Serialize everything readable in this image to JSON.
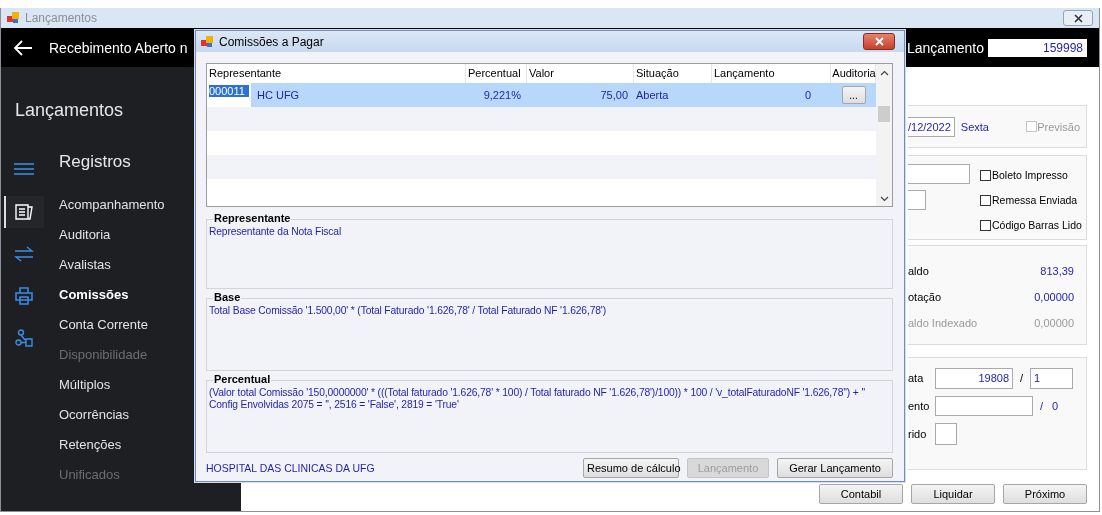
{
  "window": {
    "title": "Lançamentos"
  },
  "header": {
    "title": "Recebimento Aberto n",
    "lancamento_label": "Lançamento",
    "lancamento_value": "159998"
  },
  "sidebar": {
    "title": "Lançamentos",
    "section": "Registros",
    "icons": [
      {
        "kind": "document",
        "selected": true
      },
      {
        "kind": "arrows",
        "selected": false
      },
      {
        "kind": "printer",
        "selected": false
      },
      {
        "kind": "network",
        "selected": false
      }
    ],
    "items": [
      {
        "label": "Acompanhamento",
        "selected": false,
        "disabled": false
      },
      {
        "label": "Auditoria",
        "selected": false,
        "disabled": false
      },
      {
        "label": "Avalistas",
        "selected": false,
        "disabled": false
      },
      {
        "label": "Comissões",
        "selected": true,
        "disabled": false
      },
      {
        "label": "Conta Corrente",
        "selected": false,
        "disabled": false
      },
      {
        "label": "Disponibilidade",
        "selected": false,
        "disabled": true
      },
      {
        "label": "Múltiplos",
        "selected": false,
        "disabled": false
      },
      {
        "label": "Ocorrências",
        "selected": false,
        "disabled": false
      },
      {
        "label": "Retenções",
        "selected": false,
        "disabled": false
      },
      {
        "label": "Unificados",
        "selected": false,
        "disabled": true
      }
    ]
  },
  "right_panel": {
    "date": "/12/2022",
    "weekday": "Sexta",
    "previsao": {
      "label": "Previsão",
      "checked": false,
      "disabled": true
    },
    "checkboxes": [
      {
        "label": "Boleto Impresso",
        "checked": false
      },
      {
        "label": "Remessa Enviada",
        "checked": false
      },
      {
        "label": "Código Barras Lido",
        "checked": false
      }
    ],
    "totals": [
      {
        "label": "aldo",
        "value": "813,39",
        "disabled": false
      },
      {
        "label": "otação",
        "value": "0,00000",
        "disabled": false
      },
      {
        "label": "aldo Indexado",
        "value": "0,00000",
        "disabled": true
      }
    ],
    "parcel_rows": [
      {
        "kind": "pair",
        "label": "ata",
        "value": "19808",
        "separator": "/",
        "second_value": "1"
      },
      {
        "kind": "count",
        "label": "ento",
        "separator": "/",
        "count": "0"
      },
      {
        "kind": "small",
        "label": "rido"
      }
    ],
    "buttons": [
      {
        "label": "Contabil"
      },
      {
        "label": "Liquidar"
      },
      {
        "label": "Próximo"
      }
    ]
  },
  "dialog": {
    "title": "Comissões a Pagar",
    "grid": {
      "columns": [
        "Representante",
        "Percentual",
        "Valor",
        "Situação",
        "Lançamento",
        "Auditoria"
      ],
      "rows": [
        {
          "code": "000011",
          "name": "HC UFG",
          "percentual": "9,221%",
          "valor": "75,00",
          "situacao": "Aberta",
          "lancamento": "0",
          "auditoria": "...",
          "selected": true
        }
      ]
    },
    "groups": [
      {
        "title": "Representante",
        "lines": [
          "Representante da Nota Fiscal"
        ]
      },
      {
        "title": "Base",
        "lines": [
          "Total Base Comissão '1.500,00' * (Total Faturado '1.626,78' / Total Faturado NF '1.626,78')"
        ]
      },
      {
        "title": "Percentual",
        "lines": [
          "(Valor total Comissão '150,0000000' * (((Total faturado '1.626,78' * 100) / Total faturado NF '1.626,78')/100)) * 100 / 'v_totalFaturadoNF '1.626,78'') + ''",
          "Config Envolvidas 2075 = '', 2516 = 'False', 2819 = 'True'"
        ]
      }
    ],
    "footer_text": "HOSPITAL DAS CLINICAS DA UFG",
    "buttons": [
      {
        "label": "Resumo de cálculo",
        "disabled": false
      },
      {
        "label": "Lançamento",
        "disabled": true
      },
      {
        "label": "Gerar Lançamento",
        "disabled": false
      }
    ]
  }
}
